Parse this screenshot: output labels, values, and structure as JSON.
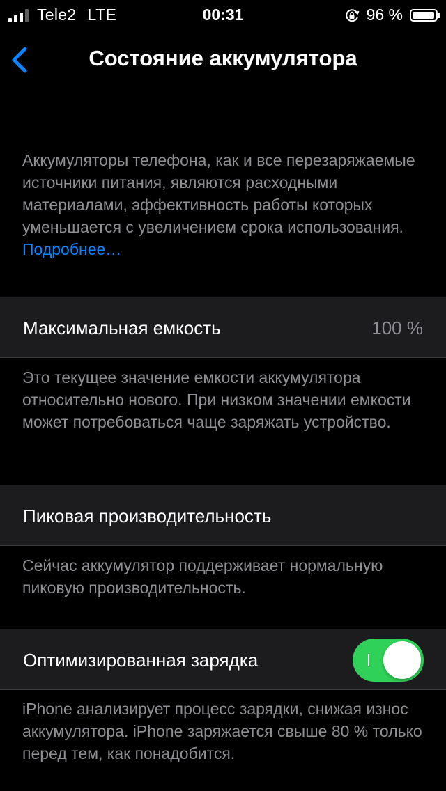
{
  "status_bar": {
    "carrier": "Tele2",
    "network": "LTE",
    "time": "00:31",
    "battery_percent": "96 %",
    "battery_level": 0.96
  },
  "nav": {
    "title": "Состояние аккумулятора",
    "back_icon": "chevron-left-icon",
    "accent_color": "#0a84ff"
  },
  "intro": {
    "text": "Аккумуляторы телефона, как и все перезаряжаемые источники питания, являются расходными материалами, эффективность работы которых уменьшается с увеличением срока использования.",
    "link": "Подробнее…"
  },
  "max_capacity": {
    "label": "Максимальная емкость",
    "value": "100 %",
    "footnote": "Это текущее значение емкости аккумулятора относительно нового. При низком значении емкости может потребоваться чаще заряжать устройство."
  },
  "peak_performance": {
    "label": "Пиковая производительность",
    "footnote": "Сейчас аккумулятор поддерживает нормальную пиковую производительность."
  },
  "optimized_charging": {
    "label": "Оптимизированная зарядка",
    "enabled": true,
    "toggle_color": "#30d158",
    "footnote": "iPhone анализирует процесс зарядки, снижая износ аккумулятора. iPhone заряжается свыше 80 % только перед тем, как понадобится."
  }
}
